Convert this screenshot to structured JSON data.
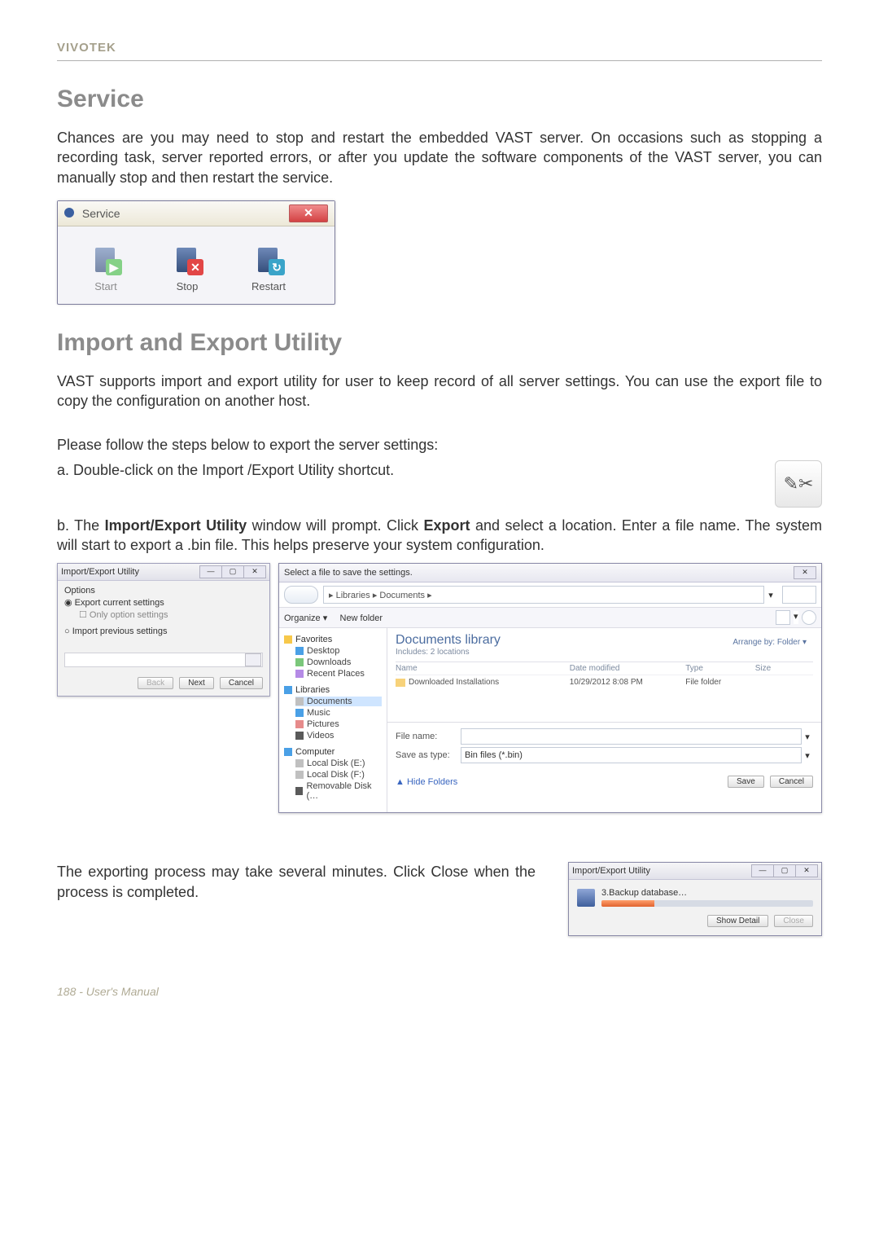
{
  "brand": "VIVOTEK",
  "sections": {
    "service": {
      "heading": "Service",
      "para": "Chances are you may need to stop and restart the embedded VAST server. On occasions such as stopping a recording task, server reported errors, or after you update the software components of the VAST server, you can manually stop and then restart the service.",
      "dialog_title": "Service",
      "start": "Start",
      "stop": "Stop",
      "restart": "Restart"
    },
    "import": {
      "heading": "Import and Export Utility",
      "para": "VAST supports import and export utility for user to keep record of all server settings. You can use the export file to copy the configuration on another host.",
      "steps_intro": "Please follow the steps below to export the server settings:",
      "step_a": "a. Double-click on the Import /Export Utility shortcut.",
      "step_b_prefix": "b. The ",
      "step_b_bold1": "Import/Export Utility",
      "step_b_mid1": " window will prompt. Click ",
      "step_b_bold2": "Export",
      "step_b_mid2": " and select a location. Enter a file name. The system will start to export a .bin file. This helps preserve your system configuration."
    },
    "wizard": {
      "title": "Import/Export Utility",
      "options": "Options",
      "radio_export": "Export current settings",
      "radio_export_sub": "Only option settings",
      "radio_import": "Import previous settings",
      "back": "Back",
      "next": "Next",
      "cancel": "Cancel"
    },
    "save": {
      "title": "Select a file to save the settings.",
      "crumb": "▸ Libraries ▸ Documents ▸",
      "organize": "Organize ▾",
      "newfolder": "New folder",
      "lib_head": "Documents library",
      "lib_sub": "Includes: 2 locations",
      "arrange": "Arrange by:  Folder ▾",
      "cols": {
        "name": "Name",
        "modified": "Date modified",
        "type": "Type",
        "size": "Size"
      },
      "row": {
        "name": "Downloaded Installations",
        "modified": "10/29/2012 8:08 PM",
        "type": "File folder",
        "size": ""
      },
      "filename_label": "File name:",
      "filename_value": "",
      "saveas_label": "Save as type:",
      "saveas_value": "Bin files (*.bin)",
      "hide": "Hide Folders",
      "save_btn": "Save",
      "cancel_btn": "Cancel",
      "tree": {
        "favorites": "Favorites",
        "desktop": "Desktop",
        "downloads": "Downloads",
        "recent": "Recent Places",
        "libraries": "Libraries",
        "documents": "Documents",
        "music": "Music",
        "pictures": "Pictures",
        "videos": "Videos",
        "computer": "Computer",
        "disk_e": "Local Disk (E:)",
        "disk_f": "Local Disk (F:)",
        "removable": "Removable Disk (…"
      }
    },
    "progress": {
      "para": "The exporting process may take several minutes. Click Close when the process is completed.",
      "title": "Import/Export Utility",
      "step": "3.Backup database…",
      "show_detail": "Show Detail",
      "close": "Close"
    }
  },
  "footer": "188 - User's Manual"
}
